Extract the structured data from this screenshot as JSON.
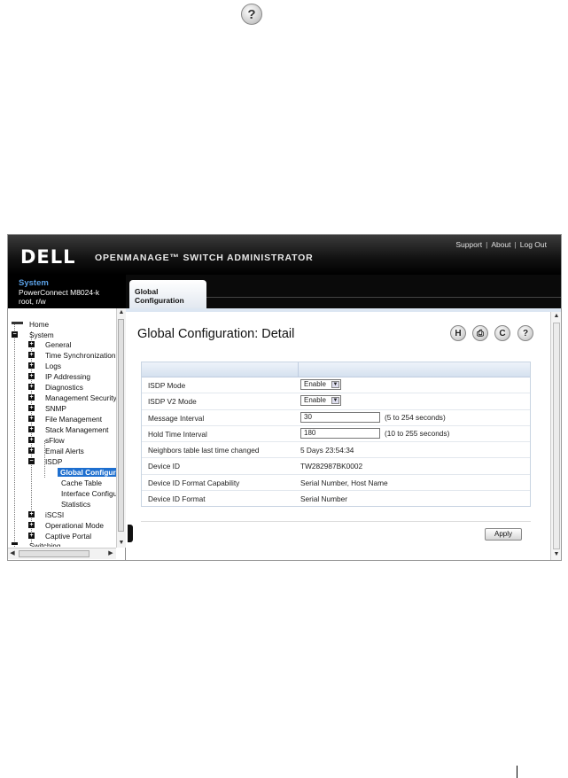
{
  "header": {
    "logo": "DELL",
    "app_title": "OPENMANAGE™ SWITCH ADMINISTRATOR",
    "links": [
      "Support",
      "About",
      "Log Out"
    ]
  },
  "system": {
    "name": "System",
    "model": "PowerConnect M8024-k",
    "user": "root, r/w"
  },
  "tab": {
    "label": "Global Configuration"
  },
  "nav": {
    "home": "Home",
    "system": "System",
    "items": [
      "General",
      "Time Synchronization",
      "Logs",
      "IP Addressing",
      "Diagnostics",
      "Management Security",
      "SNMP",
      "File Management",
      "Stack Management",
      "sFlow",
      "Email Alerts",
      "ISDP"
    ],
    "isdp_children": [
      "Global Configuration",
      "Cache Table",
      "Interface Configuration",
      "Statistics"
    ],
    "after": [
      "iSCSI",
      "Operational Mode",
      "Captive Portal"
    ],
    "partial": "Switching"
  },
  "main": {
    "title": "Global Configuration: Detail",
    "rows": [
      {
        "label": "ISDP Mode",
        "type": "select",
        "value": "Enable"
      },
      {
        "label": "ISDP V2 Mode",
        "type": "select",
        "value": "Enable"
      },
      {
        "label": "Message Interval",
        "type": "text",
        "value": "30",
        "hint": "(5 to 254 seconds)"
      },
      {
        "label": "Hold Time Interval",
        "type": "text",
        "value": "180",
        "hint": "(10 to 255 seconds)"
      },
      {
        "label": "Neighbors table last time changed",
        "type": "static",
        "value": "5 Days 23:54:34"
      },
      {
        "label": "Device ID",
        "type": "static",
        "value": "TW282987BK0002"
      },
      {
        "label": "Device ID Format Capability",
        "type": "static",
        "value": "Serial Number, Host Name"
      },
      {
        "label": "Device ID Format",
        "type": "static",
        "value": "Serial Number"
      }
    ],
    "apply_label": "Apply",
    "toolbar": {
      "save": "H",
      "print": "⎙",
      "refresh": "C",
      "help": "?"
    }
  },
  "top_help": "?"
}
